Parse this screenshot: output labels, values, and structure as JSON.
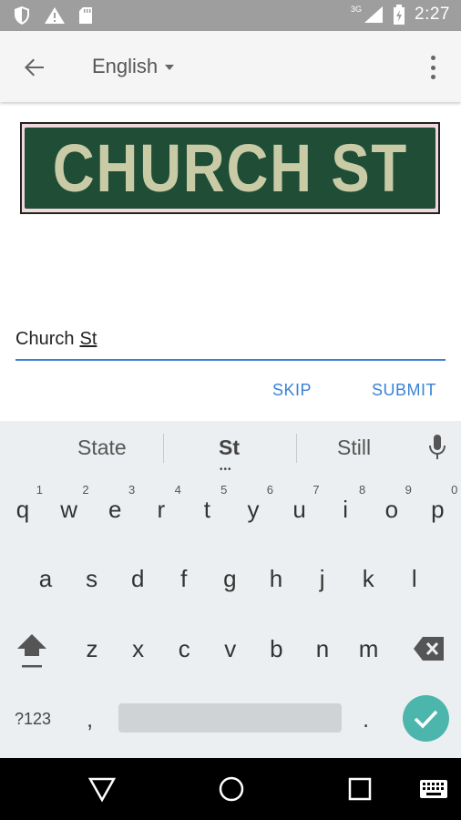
{
  "status_bar": {
    "network_label": "3G",
    "time": "2:27"
  },
  "app_bar": {
    "language": "English"
  },
  "sign_image": {
    "text": "CHURCH ST"
  },
  "input": {
    "word1": "Church",
    "word2": "St"
  },
  "actions": {
    "skip_label": "SKIP",
    "submit_label": "SUBMIT"
  },
  "keyboard": {
    "suggestions": [
      "State",
      "St",
      "Still"
    ],
    "row1": [
      {
        "key": "q",
        "num": "1"
      },
      {
        "key": "w",
        "num": "2"
      },
      {
        "key": "e",
        "num": "3"
      },
      {
        "key": "r",
        "num": "4"
      },
      {
        "key": "t",
        "num": "5"
      },
      {
        "key": "y",
        "num": "6"
      },
      {
        "key": "u",
        "num": "7"
      },
      {
        "key": "i",
        "num": "8"
      },
      {
        "key": "o",
        "num": "9"
      },
      {
        "key": "p",
        "num": "0"
      }
    ],
    "row2": [
      "a",
      "s",
      "d",
      "f",
      "g",
      "h",
      "j",
      "k",
      "l"
    ],
    "row3": [
      "z",
      "x",
      "c",
      "v",
      "b",
      "n",
      "m"
    ],
    "symbols_label": "?123",
    "comma": ",",
    "period": "."
  },
  "colors": {
    "accent": "#3b82d6",
    "enter_key": "#4db6ac",
    "sign_green": "#1f4d36"
  }
}
